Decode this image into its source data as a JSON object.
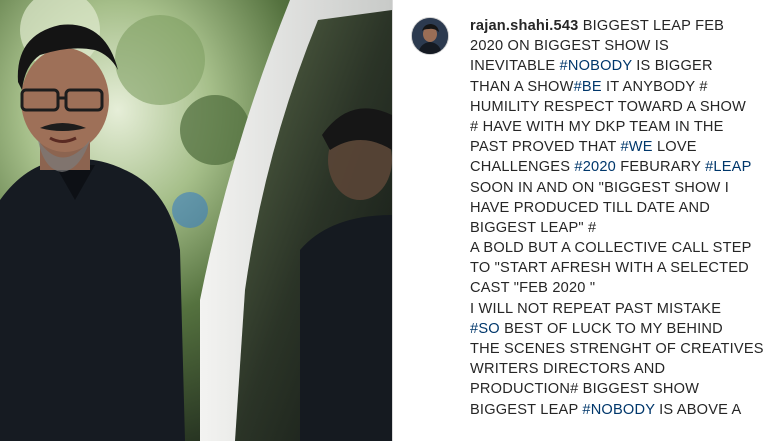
{
  "post": {
    "username": "rajan.shahi.543",
    "caption_lines": [
      [
        {
          "t": "BIGGEST LEAP FEB"
        }
      ],
      [
        {
          "t": "2020 ON BIGGEST SHOW IS"
        }
      ],
      [
        {
          "t": "INEVITABLE "
        },
        {
          "t": "#NOBODY",
          "tag": true
        },
        {
          "t": " IS BIGGER"
        }
      ],
      [
        {
          "t": "THAN A SHOW"
        },
        {
          "t": "#BE",
          "tag": true
        },
        {
          "t": " IT ANYBODY #"
        }
      ],
      [
        {
          "t": "HUMILITY RESPECT TOWARD A SHOW"
        }
      ],
      [
        {
          "t": "# HAVE WITH MY DKP TEAM IN THE"
        }
      ],
      [
        {
          "t": "PAST PROVED THAT "
        },
        {
          "t": "#WE",
          "tag": true
        },
        {
          "t": " LOVE"
        }
      ],
      [
        {
          "t": "CHALLENGES "
        },
        {
          "t": "#2020",
          "tag": true
        },
        {
          "t": " FEBURARY "
        },
        {
          "t": "#LEAP",
          "tag": true
        }
      ],
      [
        {
          "t": "SOON IN AND ON \"BIGGEST SHOW I"
        }
      ],
      [
        {
          "t": "HAVE PRODUCED TILL DATE AND"
        }
      ],
      [
        {
          "t": "BIGGEST LEAP\" #"
        }
      ],
      [
        {
          "t": "A BOLD BUT A COLLECTIVE CALL STEP"
        }
      ],
      [
        {
          "t": "TO \"START AFRESH WITH A SELECTED"
        }
      ],
      [
        {
          "t": "CAST \"FEB 2020 \""
        }
      ],
      [
        {
          "t": "I WILL NOT REPEAT PAST MISTAKE"
        }
      ],
      [
        {
          "t": "#SO",
          "tag": true
        },
        {
          "t": " BEST OF LUCK TO MY BEHIND"
        }
      ],
      [
        {
          "t": "THE SCENES STRENGHT OF CREATIVES"
        }
      ],
      [
        {
          "t": "WRITERS DIRECTORS AND"
        }
      ],
      [
        {
          "t": "PRODUCTION# BIGGEST SHOW"
        }
      ],
      [
        {
          "t": "BIGGEST LEAP "
        },
        {
          "t": "#NOBODY",
          "tag": true
        },
        {
          "t": " IS ABOVE A"
        }
      ]
    ]
  },
  "colors": {
    "text": "#262626",
    "hashtag": "#00376b",
    "border": "#dbdbdb"
  },
  "icons": {
    "avatar": "profile-avatar",
    "photo": "profile-photo"
  }
}
